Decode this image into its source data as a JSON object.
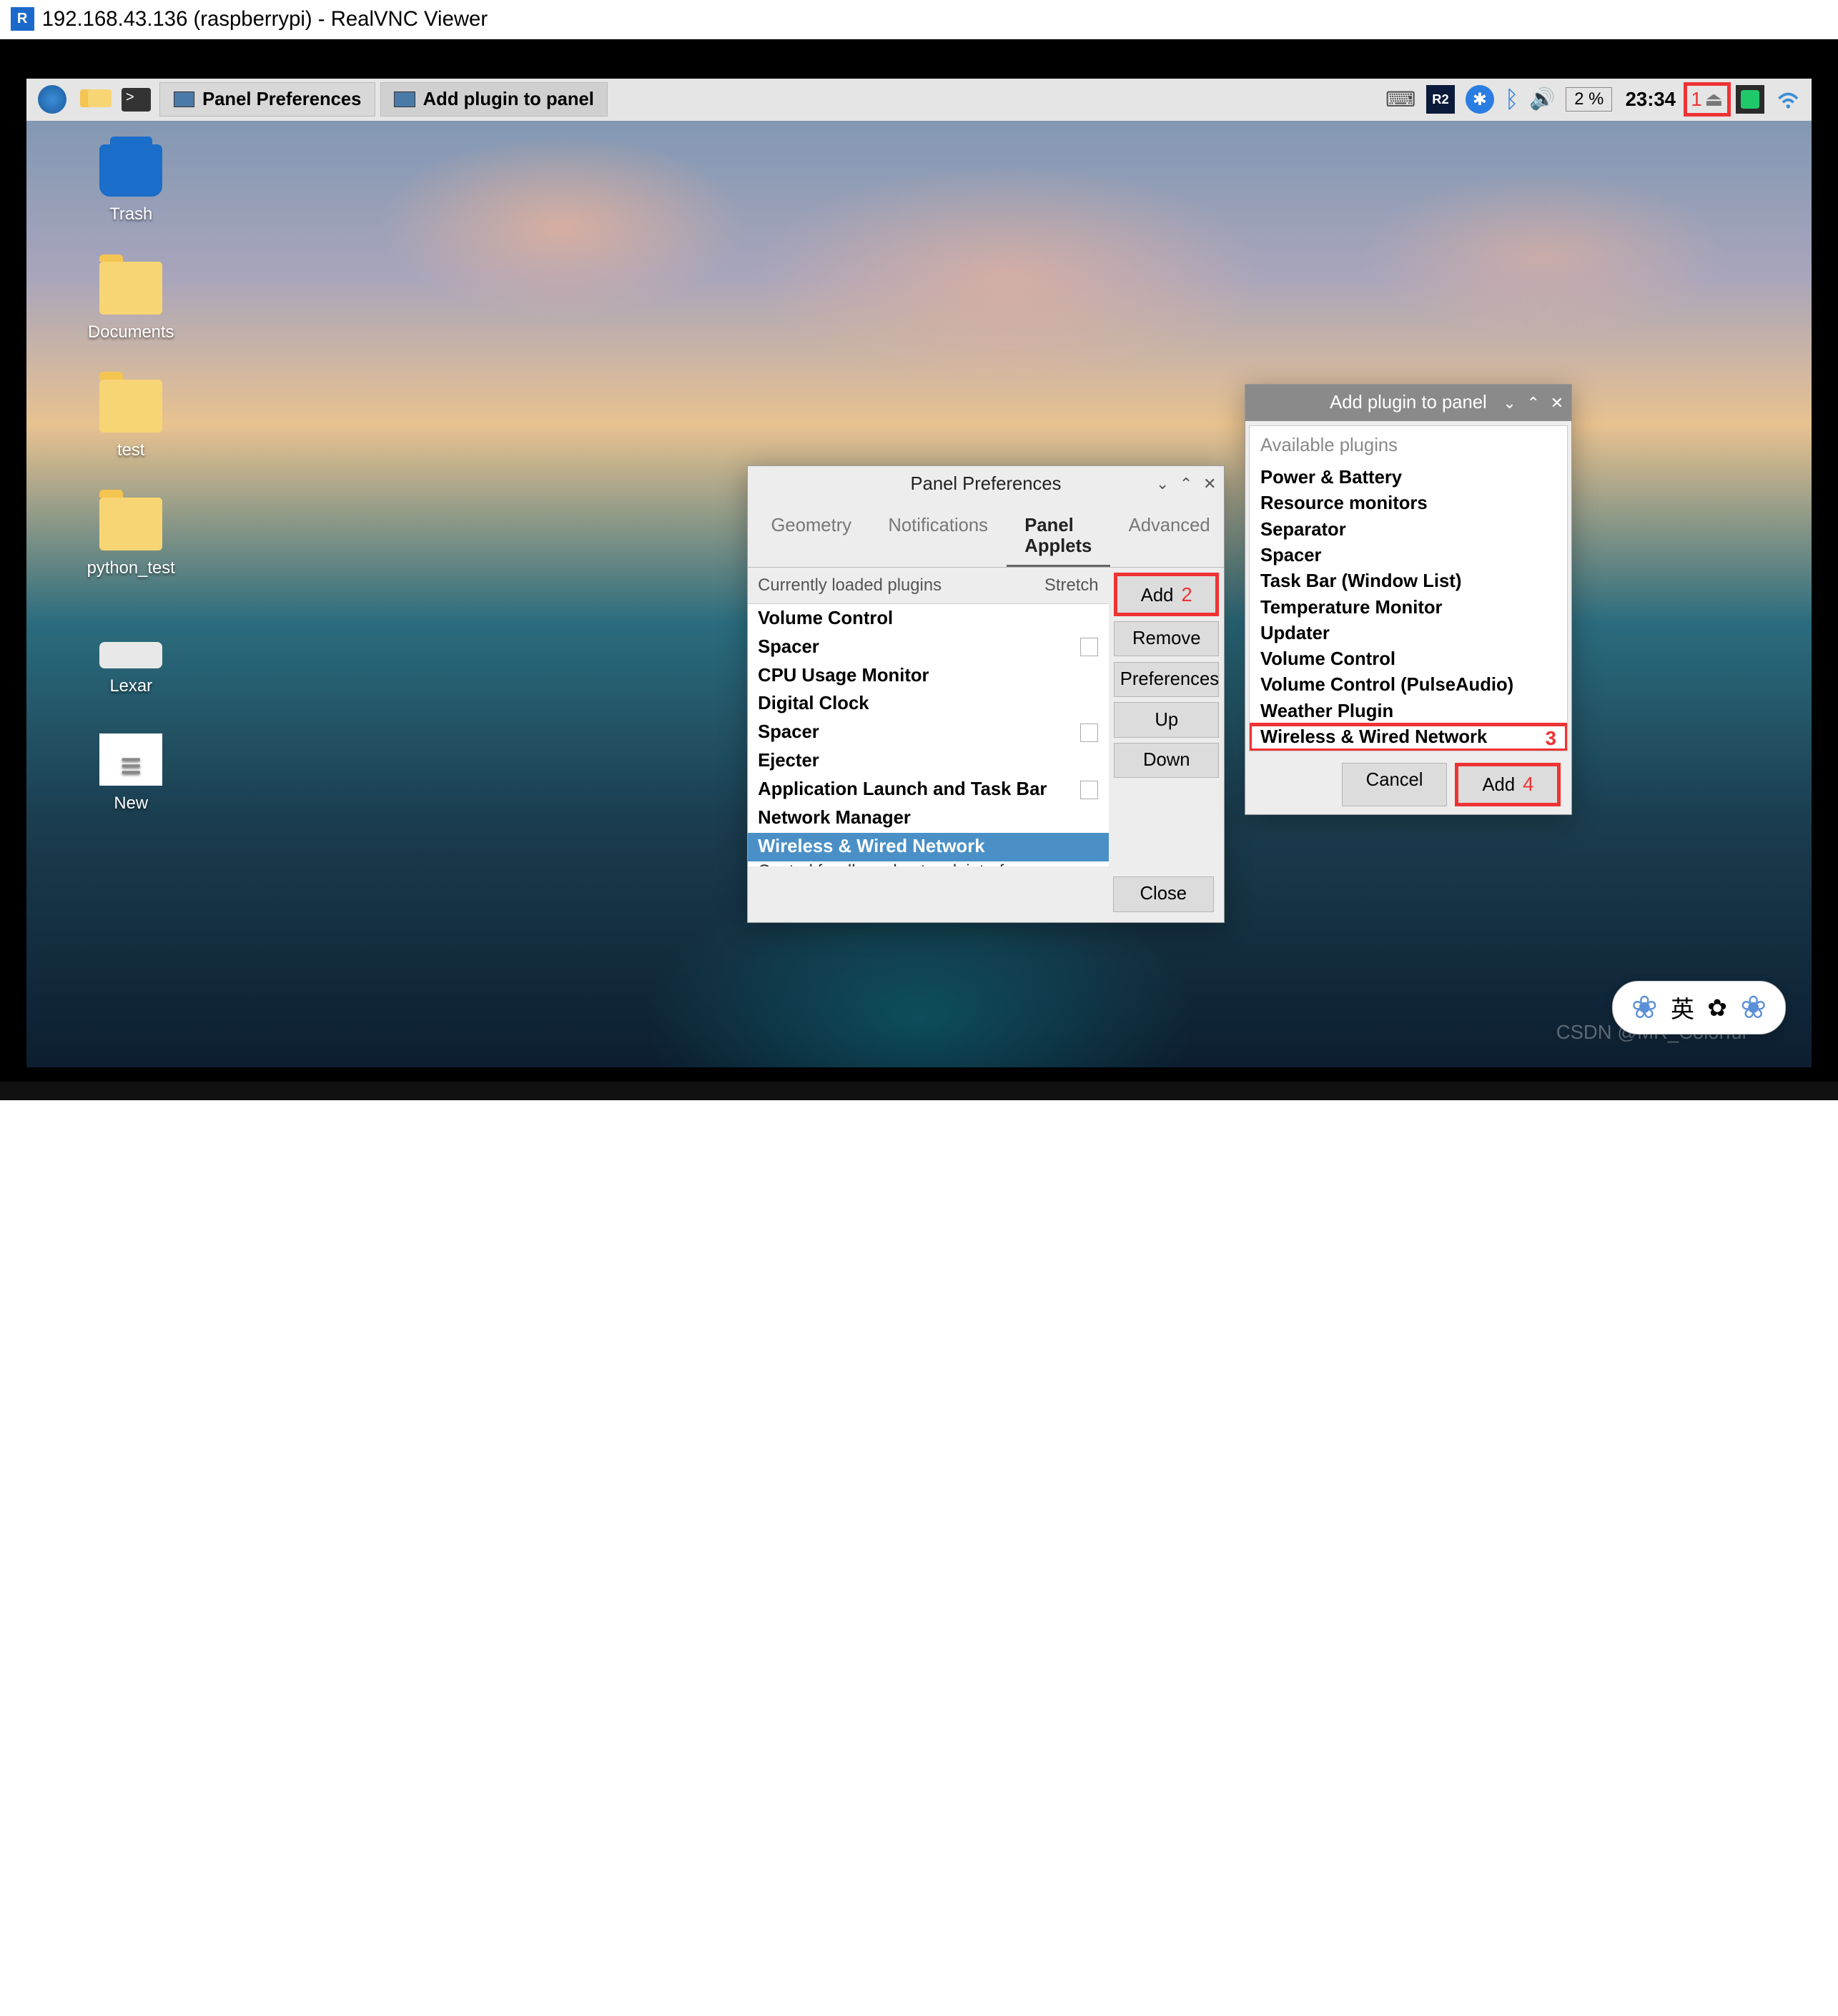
{
  "vnc": {
    "title": "192.168.43.136 (raspberrypi) - RealVNC Viewer"
  },
  "taskbar": {
    "buttons": [
      {
        "label": "Panel Preferences"
      },
      {
        "label": "Add plugin to panel"
      }
    ],
    "cpu": "2 %",
    "clock": "23:34"
  },
  "desktop": {
    "icons": [
      {
        "label": "Trash",
        "type": "trash"
      },
      {
        "label": "Documents",
        "type": "folder"
      },
      {
        "label": "test",
        "type": "folder"
      },
      {
        "label": "python_test",
        "type": "folder"
      },
      {
        "label": "Lexar",
        "type": "drive"
      },
      {
        "label": "New",
        "type": "file"
      }
    ]
  },
  "panel_prefs": {
    "title": "Panel Preferences",
    "tabs": [
      "Geometry",
      "Notifications",
      "Panel Applets",
      "Advanced"
    ],
    "active_tab": "Panel Applets",
    "header_name": "Currently loaded plugins",
    "header_stretch": "Stretch",
    "plugins": [
      {
        "name": "Volume Control",
        "checkbox": false
      },
      {
        "name": "Spacer",
        "checkbox": true
      },
      {
        "name": "CPU Usage Monitor",
        "checkbox": false
      },
      {
        "name": "Digital Clock",
        "checkbox": false
      },
      {
        "name": "Spacer",
        "checkbox": true
      },
      {
        "name": "Ejecter",
        "checkbox": false
      },
      {
        "name": "Application Launch and Task Bar",
        "checkbox": true
      },
      {
        "name": "Network Manager",
        "checkbox": false
      },
      {
        "name": "Wireless & Wired Network",
        "checkbox": false,
        "selected": true
      }
    ],
    "desc": "Control for dhcpcd network interface",
    "buttons": {
      "add": "Add",
      "remove": "Remove",
      "preferences": "Preferences",
      "up": "Up",
      "down": "Down"
    },
    "close": "Close",
    "annotation_2": "2"
  },
  "add_plugin": {
    "title": "Add plugin to panel",
    "header": "Available plugins",
    "items": [
      "Power & Battery",
      "Resource monitors",
      "Separator",
      "Spacer",
      "Task Bar (Window List)",
      "Temperature Monitor",
      "Updater",
      "Volume Control",
      "Volume Control (PulseAudio)",
      "Weather Plugin",
      "Wireless & Wired Network"
    ],
    "highlighted": "Wireless & Wired Network",
    "cancel": "Cancel",
    "add": "Add",
    "annotation_3": "3",
    "annotation_4": "4"
  },
  "annotation_1": "1",
  "ime": "英",
  "watermark": "CSDN @MR_Colorful"
}
